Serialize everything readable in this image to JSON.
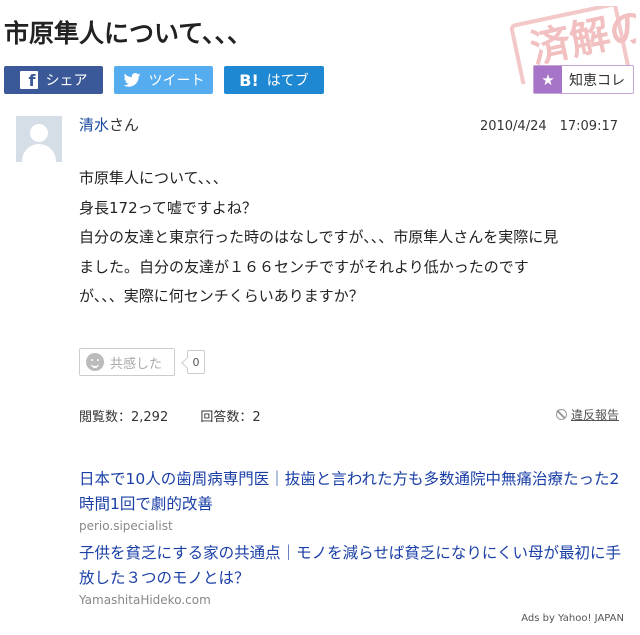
{
  "page": {
    "title": "市原隼人について、、、",
    "stamp_text": "済解の"
  },
  "share": {
    "facebook_label": "シェア",
    "twitter_label": "ツイート",
    "hatena_icon": "B!",
    "hatena_label": "はてブ",
    "chiekore_label": "知恵コレ",
    "icons": [
      "facebook-icon",
      "twitter-icon",
      "hatena-bookmark-icon",
      "star-icon"
    ]
  },
  "question": {
    "user_name": "清水",
    "user_suffix": "さん",
    "date": "2010/4/24　17:09:17",
    "body_lines": [
      "市原隼人について、、、",
      "身長172って嘘ですよね？",
      "自分の友達と東京行った時のはなしですが、、、市原隼人さんを実際に見",
      "ました。自分の友達が１６６センチですがそれより低かったのです",
      "が、、、実際に何センチくらいありますか？"
    ],
    "kyokan_label": "共感した",
    "kyokan_count": "0",
    "views_text": "閲覧数：2,292",
    "answers_text": "回答数：2",
    "report_label": "違反報告"
  },
  "ads": {
    "items": [
      {
        "title": "日本で10人の歯周病専門医｜抜歯と言われた方も多数通院中無痛治療たった2時間1回で劇的改善",
        "domain": "perio.sipecialist"
      },
      {
        "title": "子供を貧乏にする家の共通点｜モノを減らせば貧乏になりにくい母が最初に手放した３つのモノとは？",
        "domain": "YamashitaHideko.com"
      }
    ],
    "footer": "Ads by Yahoo! JAPAN"
  },
  "colors": {
    "facebook": "#3b5998",
    "twitter": "#55acee",
    "hatena": "#1f88d3",
    "chiekore": "#a775c7",
    "link": "#1a3fa6"
  }
}
